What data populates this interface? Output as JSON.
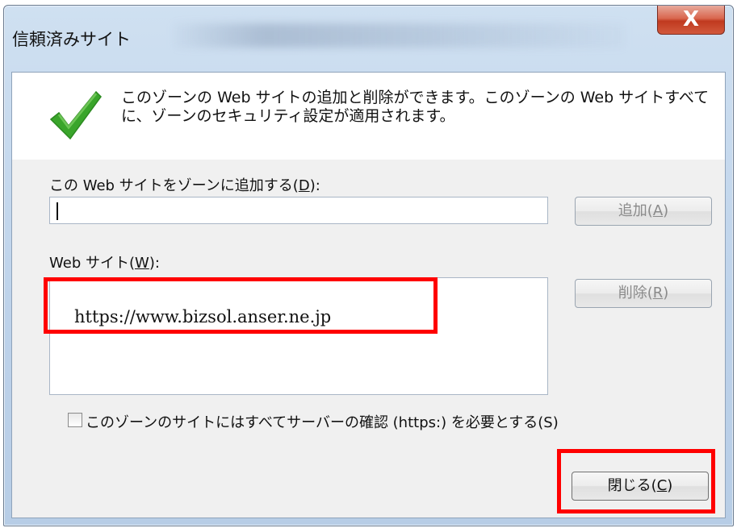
{
  "window": {
    "title": "信頼済みサイト",
    "close_glyph": "X"
  },
  "info": {
    "message": "このゾーンの Web サイトの追加と削除ができます。このゾーンの Web サイトすべてに、ゾーンのセキュリティ設定が適用されます。"
  },
  "add_section": {
    "label_prefix": "この Web サイトをゾーンに追加する(",
    "label_key": "D",
    "label_suffix": "):",
    "input_value": "",
    "add_button": {
      "prefix": "追加(",
      "key": "A",
      "suffix": ")"
    }
  },
  "sites_section": {
    "label_prefix": "Web サイト(",
    "label_key": "W",
    "label_suffix": "):",
    "sites": [
      "https://www.bizsol.anser.ne.jp"
    ],
    "remove_button": {
      "prefix": "削除(",
      "key": "R",
      "suffix": ")"
    }
  },
  "require_https": {
    "label": "このゾーンのサイトにはすべてサーバーの確認 (https:) を必要とする(S)",
    "checked": false
  },
  "close_button": {
    "prefix": "閉じる(",
    "key": "C",
    "suffix": ")"
  },
  "colors": {
    "highlight": "#ff0000",
    "check": "#3aa52b"
  },
  "icons": {
    "check": "checkmark-icon",
    "close": "close-icon"
  }
}
